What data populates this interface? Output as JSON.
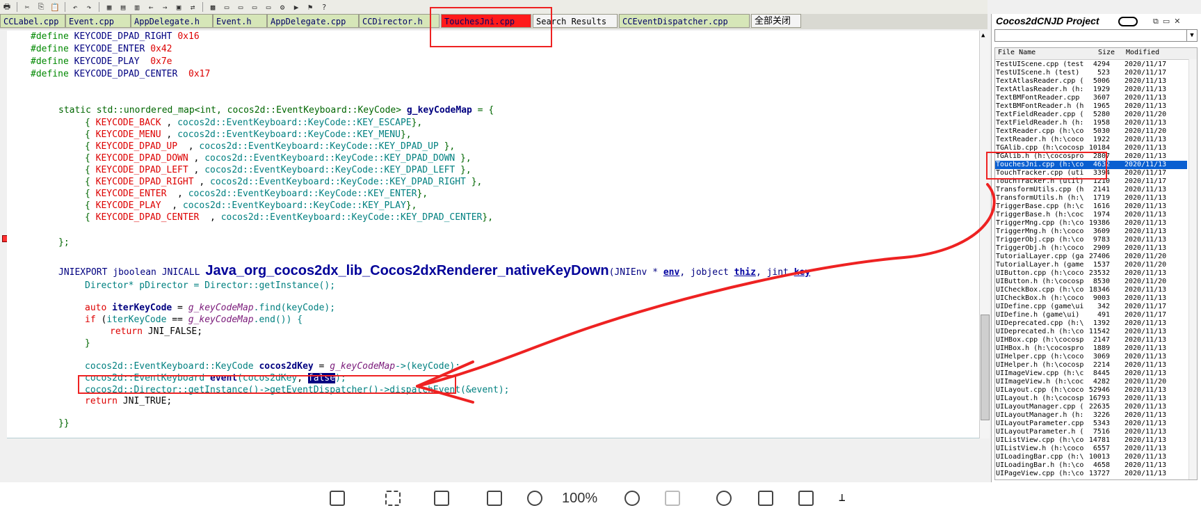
{
  "tabs": [
    {
      "label": "CCLabel.cpp",
      "style": "green"
    },
    {
      "label": "Event.cpp",
      "style": "green"
    },
    {
      "label": "AppDelegate.h",
      "style": "green"
    },
    {
      "label": "Event.h",
      "style": "green"
    },
    {
      "label": "AppDelegate.cpp",
      "style": "green"
    },
    {
      "label": "CCDirector.h",
      "style": "green"
    },
    {
      "label": "TouchesJni.cpp",
      "style": "red"
    },
    {
      "label": "Search Results",
      "style": "white"
    },
    {
      "label": "CCEventDispatcher.cpp",
      "style": "green"
    },
    {
      "label": "全部关闭",
      "style": "close"
    }
  ],
  "code": {
    "l1": {
      "kw": "#define",
      "name": "KEYCODE_DPAD_RIGHT",
      "val": "0x16"
    },
    "l2": {
      "kw": "#define",
      "name": "KEYCODE_ENTER",
      "val": "0x42"
    },
    "l3": {
      "kw": "#define",
      "name": "KEYCODE_PLAY",
      "val": "0x7e"
    },
    "l4": {
      "kw": "#define",
      "name": "KEYCODE_DPAD_CENTER",
      "val": "0x17"
    },
    "map_decl": {
      "a": "static std::unordered_map<int, cocos2d::EventKeyboard::KeyCode>",
      "b": "g_keyCodeMap",
      "c": " = {"
    },
    "entries": [
      {
        "k": "KEYCODE_BACK",
        "sep": " , ",
        "v": "cocos2d::EventKeyboard::KeyCode::KEY_ESCAPE",
        "end": "},"
      },
      {
        "k": "KEYCODE_MENU",
        "sep": " , ",
        "v": "cocos2d::EventKeyboard::KeyCode::KEY_MENU",
        "end": "},"
      },
      {
        "k": "KEYCODE_DPAD_UP",
        "sep": "  , ",
        "v": "cocos2d::EventKeyboard::KeyCode::KEY_DPAD_UP",
        "end": " },"
      },
      {
        "k": "KEYCODE_DPAD_DOWN",
        "sep": " , ",
        "v": "cocos2d::EventKeyboard::KeyCode::KEY_DPAD_DOWN",
        "end": " },"
      },
      {
        "k": "KEYCODE_DPAD_LEFT",
        "sep": " , ",
        "v": "cocos2d::EventKeyboard::KeyCode::KEY_DPAD_LEFT",
        "end": " },"
      },
      {
        "k": "KEYCODE_DPAD_RIGHT",
        "sep": " , ",
        "v": "cocos2d::EventKeyboard::KeyCode::KEY_DPAD_RIGHT",
        "end": " },"
      },
      {
        "k": "KEYCODE_ENTER",
        "sep": "  , ",
        "v": "cocos2d::EventKeyboard::KeyCode::KEY_ENTER",
        "end": "},"
      },
      {
        "k": "KEYCODE_PLAY",
        "sep": "  , ",
        "v": "cocos2d::EventKeyboard::KeyCode::KEY_PLAY",
        "end": "},"
      },
      {
        "k": "KEYCODE_DPAD_CENTER",
        "sep": "  , ",
        "v": "cocos2d::EventKeyboard::KeyCode::KEY_DPAD_CENTER",
        "end": "},"
      }
    ],
    "entry_open": "{ ",
    "map_close": "};",
    "jni_prefix": "JNIEXPORT jboolean JNICALL ",
    "jni_func": "Java_org_cocos2dx_lib_Cocos2dxRenderer_nativeKeyDown",
    "jni_args_a": "(JNIEnv * ",
    "jni_env": "env",
    "jni_args_b": ", jobject ",
    "jni_thiz": "thiz",
    "jni_args_c": ", jint ",
    "jni_key": "key",
    "director_line": "Director* pDirector = Director::getInstance();",
    "auto_kw": "auto ",
    "auto_var": "iterKeyCode",
    "auto_eq": " = ",
    "auto_map": "g_keyCodeMap",
    "auto_find": ".find(",
    "auto_arg": "keyCode",
    "auto_end": ");",
    "if_kw": "if ",
    "if_open": "(",
    "if_var": "iterKeyCode",
    "if_eq": " == ",
    "if_map": "g_keyCodeMap",
    "if_end": ".end()) {",
    "return_kw": "return ",
    "return_false": "JNI_FALSE;",
    "close_brace": "}",
    "kc_type": "cocos2d::EventKeyboard::KeyCode ",
    "kc_var": "cocos2dKey",
    "kc_eq": " = ",
    "kc_map": "g_keyCodeMap",
    "kc_rest": "->",
    "kc_arg": "(keyCode);",
    "ev_type": "cocos2d::EventKeyboard ",
    "ev_var": "event",
    "ev_open": "(",
    "ev_arg": "cocos2dKey",
    "ev_comma": ", ",
    "ev_sel": "false",
    "ev_end": ");",
    "dispatch_line": "cocos2d::Director::getInstance()->getEventDispatcher()->dispatchEvent(&event);",
    "return_true": "JNI_TRUE;",
    "func_close": "}}"
  },
  "project": {
    "title": "Cocos2dCNJD Project",
    "col_name": "File Name",
    "col_size": "Size",
    "col_mod": "Modified",
    "files": [
      {
        "n": "TestUIScene.cpp (test",
        "s": "4294",
        "m": "2020/11/17"
      },
      {
        "n": "TestUIScene.h (test)",
        "s": "523",
        "m": "2020/11/17"
      },
      {
        "n": "TextAtlasReader.cpp (",
        "s": "5006",
        "m": "2020/11/13"
      },
      {
        "n": "TextAtlasReader.h (h:",
        "s": "1929",
        "m": "2020/11/13"
      },
      {
        "n": "TextBMFontReader.cpp",
        "s": "3607",
        "m": "2020/11/13"
      },
      {
        "n": "TextBMFontReader.h (h",
        "s": "1965",
        "m": "2020/11/13"
      },
      {
        "n": "TextFieldReader.cpp (",
        "s": "5280",
        "m": "2020/11/20"
      },
      {
        "n": "TextFieldReader.h (h:",
        "s": "1958",
        "m": "2020/11/13"
      },
      {
        "n": "TextReader.cpp (h:\\co",
        "s": "5030",
        "m": "2020/11/20"
      },
      {
        "n": "TextReader.h (h:\\coco",
        "s": "1922",
        "m": "2020/11/13"
      },
      {
        "n": "TGAlib.cpp (h:\\cocosp",
        "s": "10184",
        "m": "2020/11/13"
      },
      {
        "n": "TGAlib.h (h:\\cocospro",
        "s": "2807",
        "m": "2020/11/13"
      },
      {
        "n": "TouchesJni.cpp (h:\\co",
        "s": "4632",
        "m": "2020/11/13"
      },
      {
        "n": "TouchTracker.cpp (uti",
        "s": "3394",
        "m": "2020/11/17"
      },
      {
        "n": "TouchTracker.h (util)",
        "s": "1210",
        "m": "2020/11/17"
      },
      {
        "n": "TransformUtils.cpp (h",
        "s": "2141",
        "m": "2020/11/13"
      },
      {
        "n": "TransformUtils.h (h:\\",
        "s": "1719",
        "m": "2020/11/13"
      },
      {
        "n": "TriggerBase.cpp (h:\\c",
        "s": "1616",
        "m": "2020/11/13"
      },
      {
        "n": "TriggerBase.h (h:\\coc",
        "s": "1974",
        "m": "2020/11/13"
      },
      {
        "n": "TriggerMng.cpp (h:\\co",
        "s": "19386",
        "m": "2020/11/13"
      },
      {
        "n": "TriggerMng.h (h:\\coco",
        "s": "3609",
        "m": "2020/11/13"
      },
      {
        "n": "TriggerObj.cpp (h:\\co",
        "s": "9783",
        "m": "2020/11/13"
      },
      {
        "n": "TriggerObj.h (h:\\coco",
        "s": "2909",
        "m": "2020/11/13"
      },
      {
        "n": "TutorialLayer.cpp (ga",
        "s": "27406",
        "m": "2020/11/20"
      },
      {
        "n": "TutorialLayer.h (game",
        "s": "1537",
        "m": "2020/11/20"
      },
      {
        "n": "UIButton.cpp (h:\\coco",
        "s": "23532",
        "m": "2020/11/13"
      },
      {
        "n": "UIButton.h (h:\\cocosp",
        "s": "8530",
        "m": "2020/11/20"
      },
      {
        "n": "UICheckBox.cpp (h:\\co",
        "s": "18346",
        "m": "2020/11/13"
      },
      {
        "n": "UICheckBox.h (h:\\coco",
        "s": "9003",
        "m": "2020/11/13"
      },
      {
        "n": "UIDefine.cpp (game\\ui",
        "s": "342",
        "m": "2020/11/17"
      },
      {
        "n": "UIDefine.h (game\\ui)",
        "s": "491",
        "m": "2020/11/17"
      },
      {
        "n": "UIDeprecated.cpp (h:\\",
        "s": "1392",
        "m": "2020/11/13"
      },
      {
        "n": "UIDeprecated.h (h:\\co",
        "s": "11542",
        "m": "2020/11/13"
      },
      {
        "n": "UIHBox.cpp (h:\\cocosp",
        "s": "2147",
        "m": "2020/11/13"
      },
      {
        "n": "UIHBox.h (h:\\cocospro",
        "s": "1889",
        "m": "2020/11/13"
      },
      {
        "n": "UIHelper.cpp (h:\\coco",
        "s": "3069",
        "m": "2020/11/13"
      },
      {
        "n": "UIHelper.h (h:\\cocosp",
        "s": "2214",
        "m": "2020/11/13"
      },
      {
        "n": "UIImageView.cpp (h:\\c",
        "s": "8445",
        "m": "2020/11/13"
      },
      {
        "n": "UIImageView.h (h:\\coc",
        "s": "4282",
        "m": "2020/11/20"
      },
      {
        "n": "UILayout.cpp (h:\\coco",
        "s": "52946",
        "m": "2020/11/13"
      },
      {
        "n": "UILayout.h (h:\\cocosp",
        "s": "16793",
        "m": "2020/11/13"
      },
      {
        "n": "UILayoutManager.cpp (",
        "s": "22635",
        "m": "2020/11/13"
      },
      {
        "n": "UILayoutManager.h (h:",
        "s": "3226",
        "m": "2020/11/13"
      },
      {
        "n": "UILayoutParameter.cpp",
        "s": "5343",
        "m": "2020/11/13"
      },
      {
        "n": "UILayoutParameter.h (",
        "s": "7516",
        "m": "2020/11/13"
      },
      {
        "n": "UIListView.cpp (h:\\co",
        "s": "14781",
        "m": "2020/11/13"
      },
      {
        "n": "UIListView.h (h:\\coco",
        "s": "6557",
        "m": "2020/11/13"
      },
      {
        "n": "UILoadingBar.cpp (h:\\",
        "s": "10013",
        "m": "2020/11/13"
      },
      {
        "n": "UILoadingBar.h (h:\\co",
        "s": "4658",
        "m": "2020/11/13"
      },
      {
        "n": "UIPageView.cpp (h:\\co",
        "s": "13727",
        "m": "2020/11/13"
      }
    ]
  },
  "bottom": {
    "zoom": "100%"
  },
  "colors": {
    "annotation": "#ee2222",
    "selected_row": "#0a5fd1",
    "tab_active": "#ff1a1a",
    "tab_green": "#d6e6b8"
  }
}
